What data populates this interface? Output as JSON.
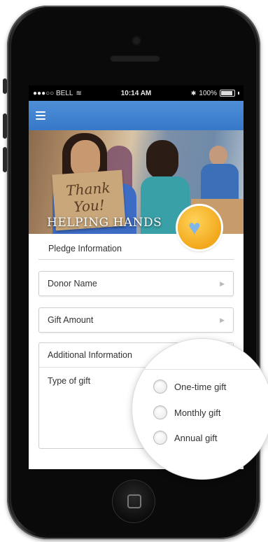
{
  "status_bar": {
    "carrier": "●●●○○ BELL",
    "time": "10:14 AM",
    "battery": "100%"
  },
  "navbar": {
    "menu_icon": "hamburger-menu-icon"
  },
  "hero": {
    "title": "HELPING HANDS",
    "sign_text": "Thank You!",
    "logo_icon": "heart-handshake-icon"
  },
  "form": {
    "section_title": "Pledge Information",
    "donor_name": "Donor Name",
    "gift_amount": "Gift Amount",
    "additional_info": "Additional Information",
    "type_of_gift": "Type of gift",
    "options": [
      "One-time gift",
      "Monthly gift",
      "Annual gift"
    ]
  },
  "colors": {
    "navbar": "#3678c9",
    "logo": "#f2a81c"
  }
}
